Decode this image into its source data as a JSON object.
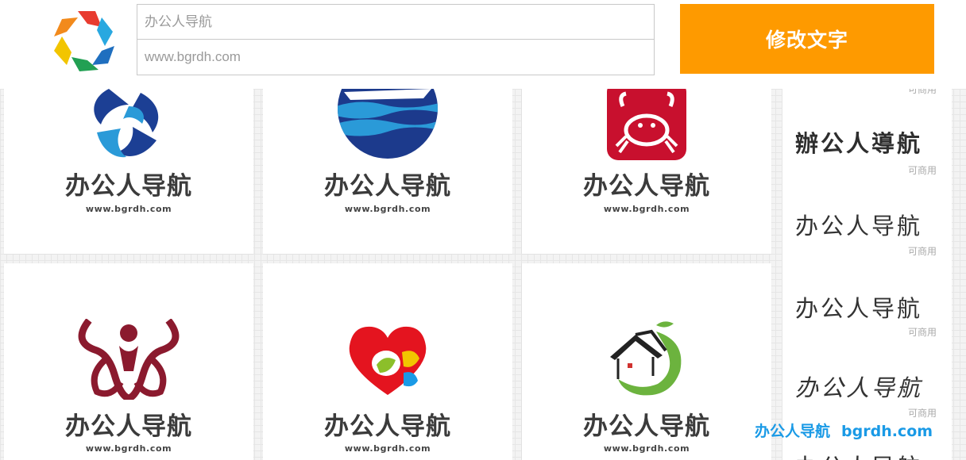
{
  "header": {
    "name_input_value": "办公人导航",
    "url_input_value": "www.bgrdh.com",
    "edit_button_label": "修改文字",
    "accent_color": "#fe9a00"
  },
  "cards": [
    {
      "brand": "办公人导航",
      "url": "www.bgrdh.com",
      "icon": "swirl-fish-icon"
    },
    {
      "brand": "办公人导航",
      "url": "www.bgrdh.com",
      "icon": "ship-waves-icon"
    },
    {
      "brand": "办公人导航",
      "url": "www.bgrdh.com",
      "icon": "crab-icon"
    },
    {
      "brand": "办公人导航",
      "url": "www.bgrdh.com",
      "icon": "ox-horns-icon"
    },
    {
      "brand": "办公人导航",
      "url": "www.bgrdh.com",
      "icon": "heart-drops-icon"
    },
    {
      "brand": "办公人导航",
      "url": "www.bgrdh.com",
      "icon": "house-leaf-icon"
    }
  ],
  "sidebar": {
    "items": [
      {
        "text": "",
        "license": "可商用"
      },
      {
        "text": "辦公人導航",
        "license": "可商用"
      },
      {
        "text": "办公人导航",
        "license": "可商用"
      },
      {
        "text": "办公人导航",
        "license": "可商用"
      },
      {
        "text": "办公人导航",
        "license": "可商用"
      },
      {
        "text": "办公人导航",
        "license": ""
      }
    ]
  },
  "watermark": {
    "name": "办公人导航",
    "domain": "bgrdh.com"
  }
}
